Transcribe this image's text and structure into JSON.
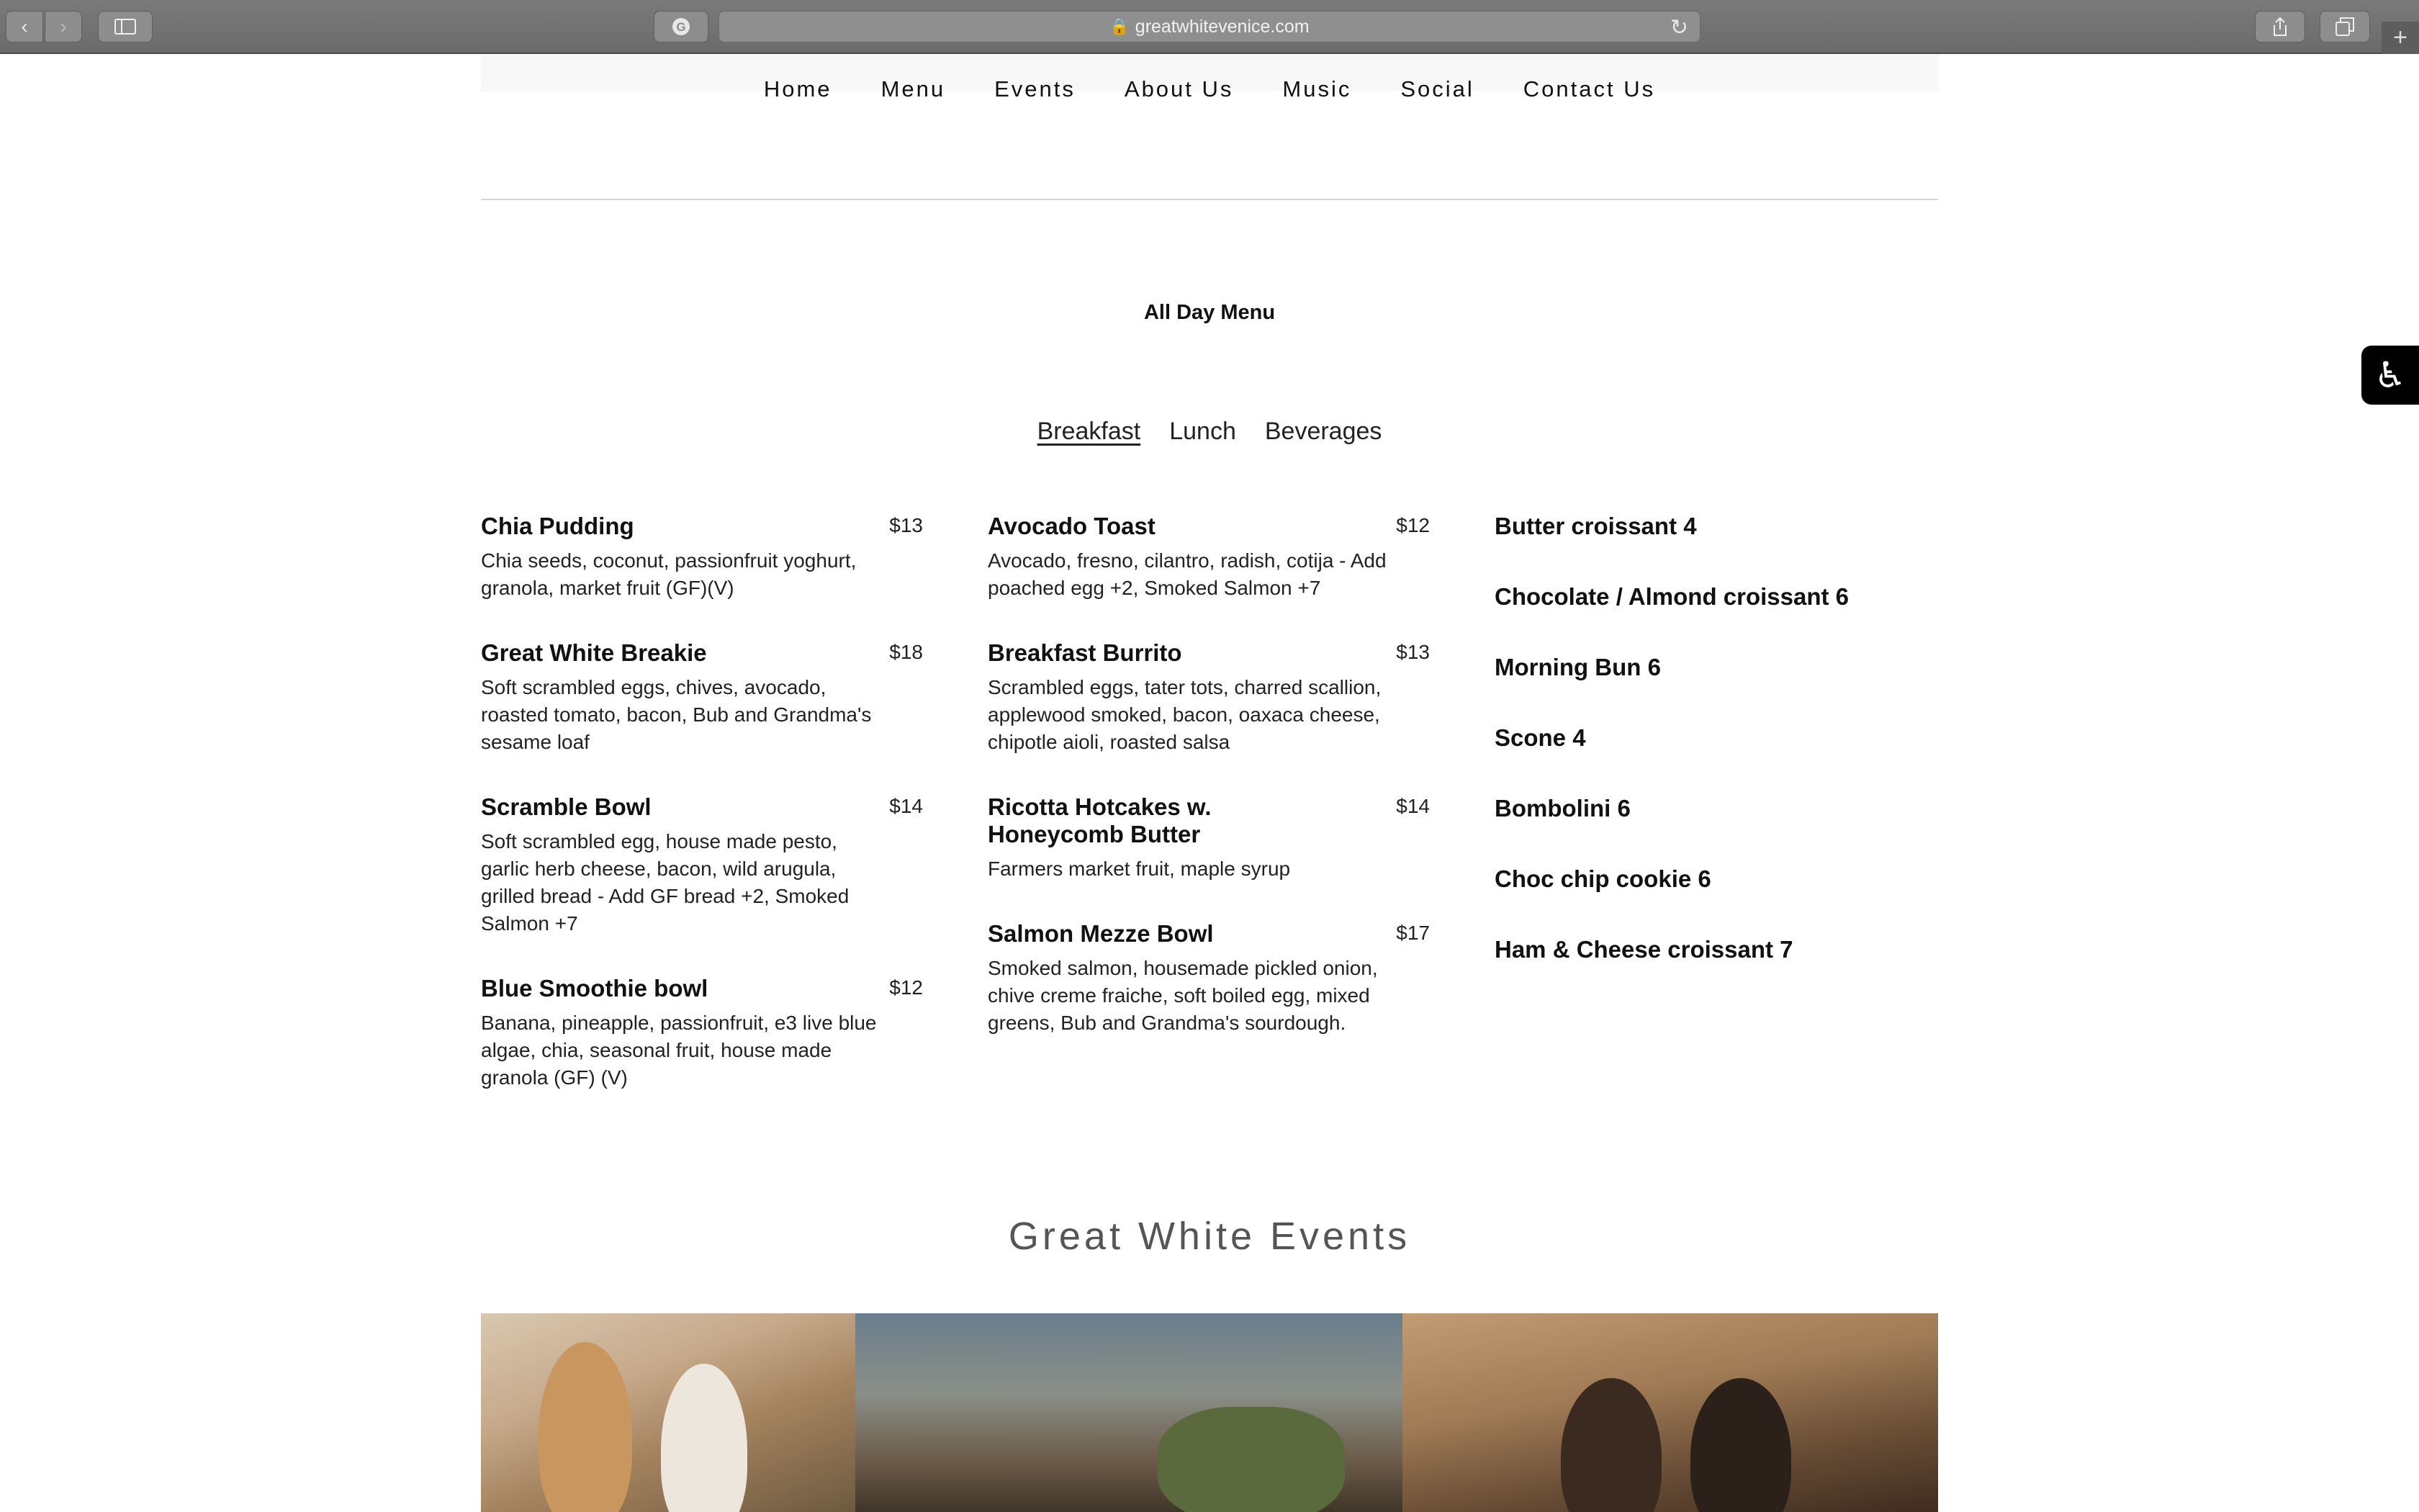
{
  "browser": {
    "url": "greatwhitevenice.com"
  },
  "nav": {
    "items": [
      "Home",
      "Menu",
      "Events",
      "About Us",
      "Music",
      "Social",
      "Contact Us"
    ]
  },
  "menu": {
    "title": "All Day Menu",
    "tabs": [
      "Breakfast",
      "Lunch",
      "Beverages"
    ],
    "active_tab": "Breakfast",
    "column1": [
      {
        "name": "Chia Pudding",
        "price": "$13",
        "desc": "Chia seeds, coconut, passionfruit yoghurt, granola, market fruit (GF)(V)"
      },
      {
        "name": "Great White Breakie",
        "price": "$18",
        "desc": "Soft scrambled eggs, chives, avocado, roasted tomato, bacon, Bub and Grandma's sesame loaf"
      },
      {
        "name": "Scramble Bowl",
        "price": "$14",
        "desc": "Soft scrambled egg, house made pesto, garlic herb cheese, bacon, wild arugula, grilled bread - Add GF bread +2, Smoked Salmon +7"
      },
      {
        "name": "Blue Smoothie bowl",
        "price": "$12",
        "desc": "Banana, pineapple, passionfruit, e3 live blue algae, chia, seasonal fruit, house made granola (GF) (V)"
      }
    ],
    "column2": [
      {
        "name": "Avocado Toast",
        "price": "$12",
        "desc": "Avocado, fresno, cilantro, radish, cotija - Add poached egg +2, Smoked Salmon +7"
      },
      {
        "name": "Breakfast Burrito",
        "price": "$13",
        "desc": "Scrambled eggs, tater tots, charred scallion, applewood smoked, bacon, oaxaca cheese, chipotle aioli, roasted salsa"
      },
      {
        "name": "Ricotta Hotcakes w. Honeycomb Butter",
        "price": "$14",
        "desc": "Farmers market fruit, maple syrup"
      },
      {
        "name": "Salmon Mezze Bowl",
        "price": "$17",
        "desc": "Smoked salmon, housemade pickled onion, chive creme fraiche, soft boiled egg, mixed greens, Bub and Grandma's sourdough."
      }
    ],
    "pastries": [
      "Butter croissant 4",
      "Chocolate / Almond croissant 6",
      "Morning Bun 6",
      "Scone 4",
      "Bombolini 6",
      "Choc chip cookie 6",
      "Ham & Cheese croissant 7"
    ]
  },
  "events": {
    "title": "Great White Events"
  },
  "icons": {
    "back": "chevron-left-icon",
    "forward": "chevron-right-icon",
    "sidebar": "sidebar-icon",
    "extension": "grammarly-icon",
    "lock": "lock-icon",
    "reload": "reload-icon",
    "share": "share-icon",
    "tabs": "tabs-icon",
    "new_tab": "plus-icon",
    "accessibility": "accessibility-icon"
  }
}
